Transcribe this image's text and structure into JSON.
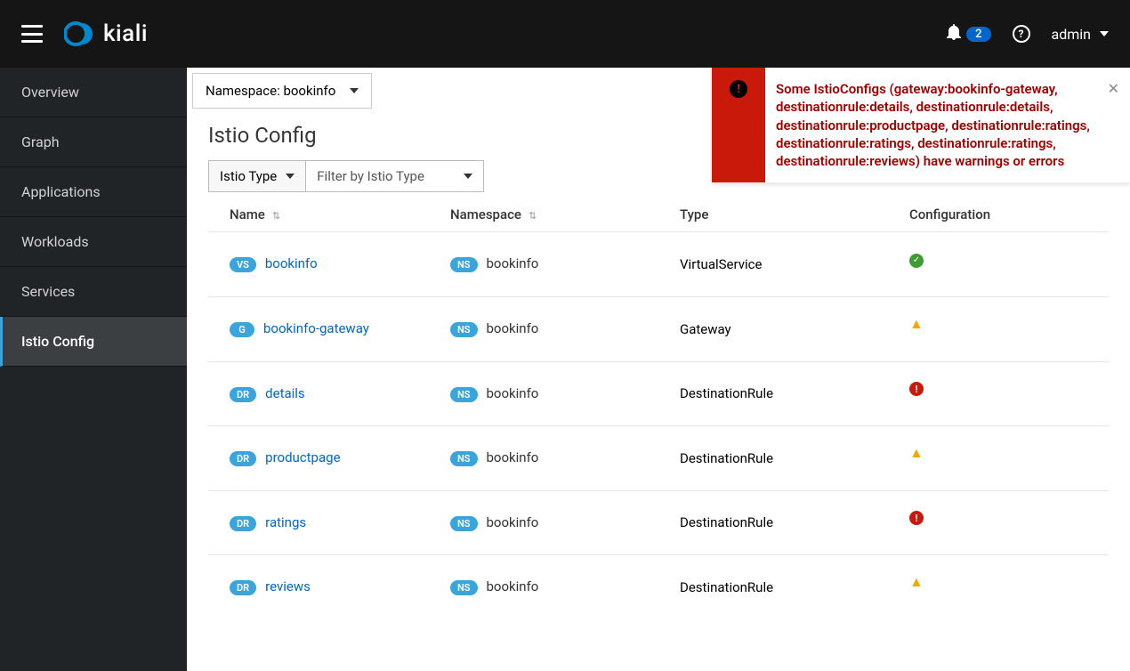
{
  "header": {
    "brand": "kiali",
    "notification_count": "2",
    "help": "?",
    "user": "admin"
  },
  "sidebar": {
    "items": [
      {
        "label": "Overview",
        "active": false
      },
      {
        "label": "Graph",
        "active": false
      },
      {
        "label": "Applications",
        "active": false
      },
      {
        "label": "Workloads",
        "active": false
      },
      {
        "label": "Services",
        "active": false
      },
      {
        "label": "Istio Config",
        "active": true
      }
    ]
  },
  "namespace_selector": {
    "label": "Namespace: bookinfo"
  },
  "page": {
    "title": "Istio Config"
  },
  "filters": {
    "type_dd": "Istio Type",
    "filter_placeholder": "Filter by Istio Type"
  },
  "columns": {
    "name": "Name",
    "namespace": "Namespace",
    "type": "Type",
    "config": "Configuration"
  },
  "rows": [
    {
      "badge": "VS",
      "name": "bookinfo",
      "ns_badge": "NS",
      "namespace": "bookinfo",
      "type": "VirtualService",
      "status": "ok"
    },
    {
      "badge": "G",
      "name": "bookinfo-gateway",
      "ns_badge": "NS",
      "namespace": "bookinfo",
      "type": "Gateway",
      "status": "warn"
    },
    {
      "badge": "DR",
      "name": "details",
      "ns_badge": "NS",
      "namespace": "bookinfo",
      "type": "DestinationRule",
      "status": "err"
    },
    {
      "badge": "DR",
      "name": "productpage",
      "ns_badge": "NS",
      "namespace": "bookinfo",
      "type": "DestinationRule",
      "status": "warn"
    },
    {
      "badge": "DR",
      "name": "ratings",
      "ns_badge": "NS",
      "namespace": "bookinfo",
      "type": "DestinationRule",
      "status": "err"
    },
    {
      "badge": "DR",
      "name": "reviews",
      "ns_badge": "NS",
      "namespace": "bookinfo",
      "type": "DestinationRule",
      "status": "warn"
    }
  ],
  "alert": {
    "message": "Some IstioConfigs (gateway:bookinfo-gateway, destinationrule:details, destinationrule:details, destinationrule:productpage, destinationrule:ratings, destinationrule:ratings, destinationrule:ratings, destinationrule:reviews) have warnings or errors"
  }
}
